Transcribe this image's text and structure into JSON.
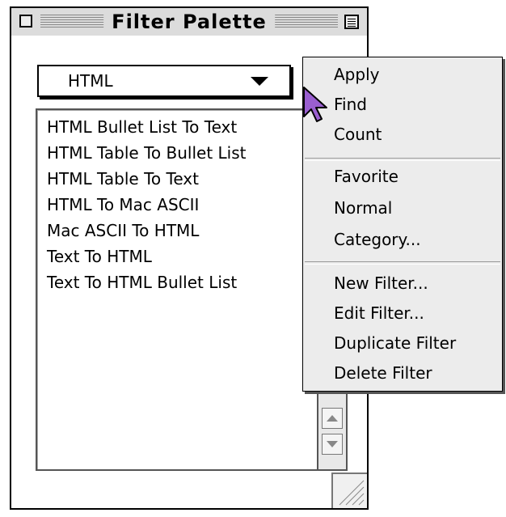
{
  "window": {
    "title": "Filter Palette"
  },
  "popup": {
    "selected": "HTML"
  },
  "filters": [
    "HTML Bullet List To Text",
    "HTML Table To Bullet List",
    "HTML Table To Text",
    "HTML To Mac ASCII",
    "Mac ASCII To HTML",
    "Text To HTML",
    "Text To HTML Bullet List"
  ],
  "menu": {
    "group1": [
      "Apply",
      "Find",
      "Count"
    ],
    "group2": [
      "Favorite",
      "Normal",
      "Category..."
    ],
    "group3": [
      "New Filter...",
      "Edit Filter...",
      "Duplicate Filter",
      "Delete Filter"
    ]
  },
  "colors": {
    "cursor": "#9a5fd0"
  }
}
